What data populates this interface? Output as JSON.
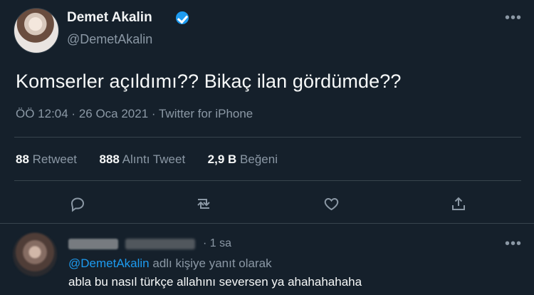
{
  "tweet": {
    "display_name": "Demet Akalin",
    "handle": "@DemetAkalin",
    "text": "Komserler açıldımı?? Bikaç ilan gördümde??",
    "time_date": "ÖÖ 12:04 · 26 Oca 2021",
    "source_sep": " · ",
    "source": "Twitter for iPhone",
    "stats": {
      "retweet_count": "88",
      "retweet_label": "Retweet",
      "quote_count": "888",
      "quote_label": "Alıntı Tweet",
      "like_count": "2,9 B",
      "like_label": "Beğeni"
    }
  },
  "reply": {
    "time": "· 1 sa",
    "replying_prefix": "",
    "replying_mention": "@DemetAkalin",
    "replying_suffix": " adlı kişiye yanıt olarak",
    "text": "abla bu nasıl türkçe allahını seversen ya ahahahahaha"
  },
  "icons": {
    "more": "more-horizontal-icon",
    "reply": "reply-icon",
    "retweet": "retweet-icon",
    "like": "heart-icon",
    "share": "share-icon"
  },
  "colors": {
    "background": "#15202b",
    "accent": "#1d9bf0",
    "secondary_text": "#8b98a5"
  }
}
